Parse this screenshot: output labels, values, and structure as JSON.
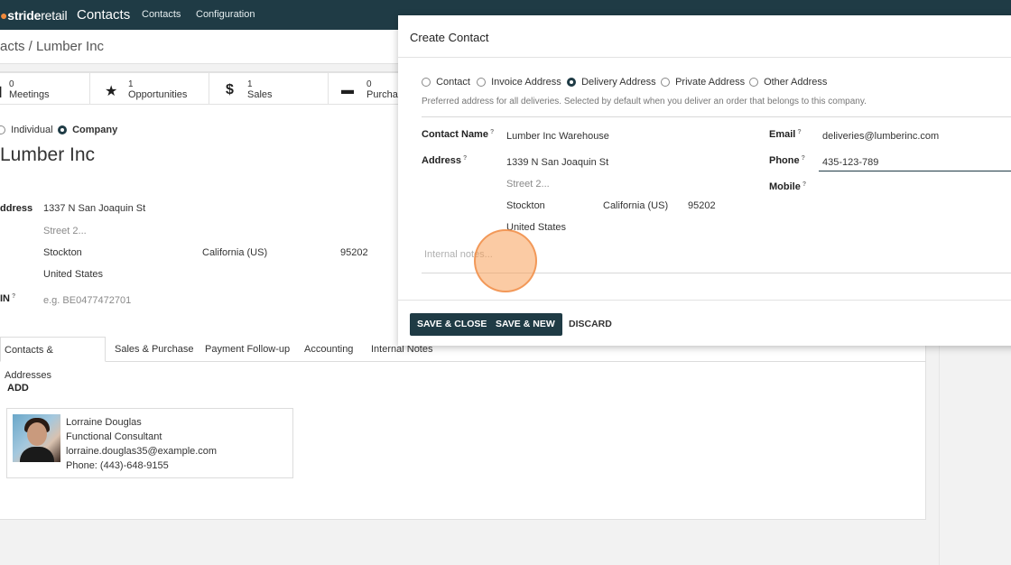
{
  "topbar": {
    "brand_main": "stride",
    "brand_light": "retail",
    "app_name": "Contacts",
    "nav": [
      "Contacts",
      "Configuration"
    ]
  },
  "breadcrumb": "acts / Lumber Inc",
  "stats": [
    {
      "icon": "calendar-icon",
      "count": "0",
      "label": "Meetings"
    },
    {
      "icon": "star-icon",
      "count": "1",
      "label": "Opportunities"
    },
    {
      "icon": "dollar-icon",
      "count": "1",
      "label": "Sales"
    },
    {
      "icon": "credit-card-icon",
      "count": "0",
      "label": "Purchas"
    }
  ],
  "company_type": {
    "options": [
      "Individual",
      "Company"
    ],
    "selected": "Company"
  },
  "company_name": "Lumber Inc",
  "address": {
    "label": "ddress",
    "street": "1337 N San Joaquin St",
    "street2_placeholder": "Street 2...",
    "city": "Stockton",
    "state": "California (US)",
    "zip": "95202",
    "country": "United States"
  },
  "vat": {
    "label": "IN",
    "placeholder": "e.g. BE0477472701"
  },
  "tabs": [
    "Contacts & Addresses",
    "Sales & Purchase",
    "Payment Follow-up",
    "Accounting",
    "Internal Notes"
  ],
  "active_tab": "Contacts & Addresses",
  "add_label": "ADD",
  "contact_card": {
    "name": "Lorraine Douglas",
    "title": "Functional Consultant",
    "email": "lorraine.douglas35@example.com",
    "phone": "Phone: (443)-648-9155"
  },
  "modal": {
    "title": "Create Contact",
    "types": [
      "Contact",
      "Invoice Address",
      "Delivery Address",
      "Private Address",
      "Other Address"
    ],
    "selected_type": "Delivery Address",
    "type_help": "Preferred address for all deliveries. Selected by default when you deliver an order that belongs to this company.",
    "contact_name_label": "Contact Name",
    "contact_name": "Lumber Inc Warehouse",
    "address_label": "Address",
    "street": "1339 N San Joaquin St",
    "street2_placeholder": "Street 2...",
    "city": "Stockton",
    "state": "California (US)",
    "zip": "95202",
    "country": "United States",
    "email_label": "Email",
    "email": "deliveries@lumberinc.com",
    "phone_label": "Phone",
    "phone": "435-123-789",
    "mobile_label": "Mobile",
    "notes_placeholder": "Internal notes...",
    "help_mark": "?",
    "buttons": {
      "save_close": "SAVE & CLOSE",
      "save_new": "SAVE & NEW",
      "discard": "DISCARD"
    }
  },
  "colors": {
    "nav_bg": "#1f3b45",
    "primary": "#1f3b45",
    "brand_dot": "#f08a3c",
    "cursor": "#f7a05a"
  }
}
